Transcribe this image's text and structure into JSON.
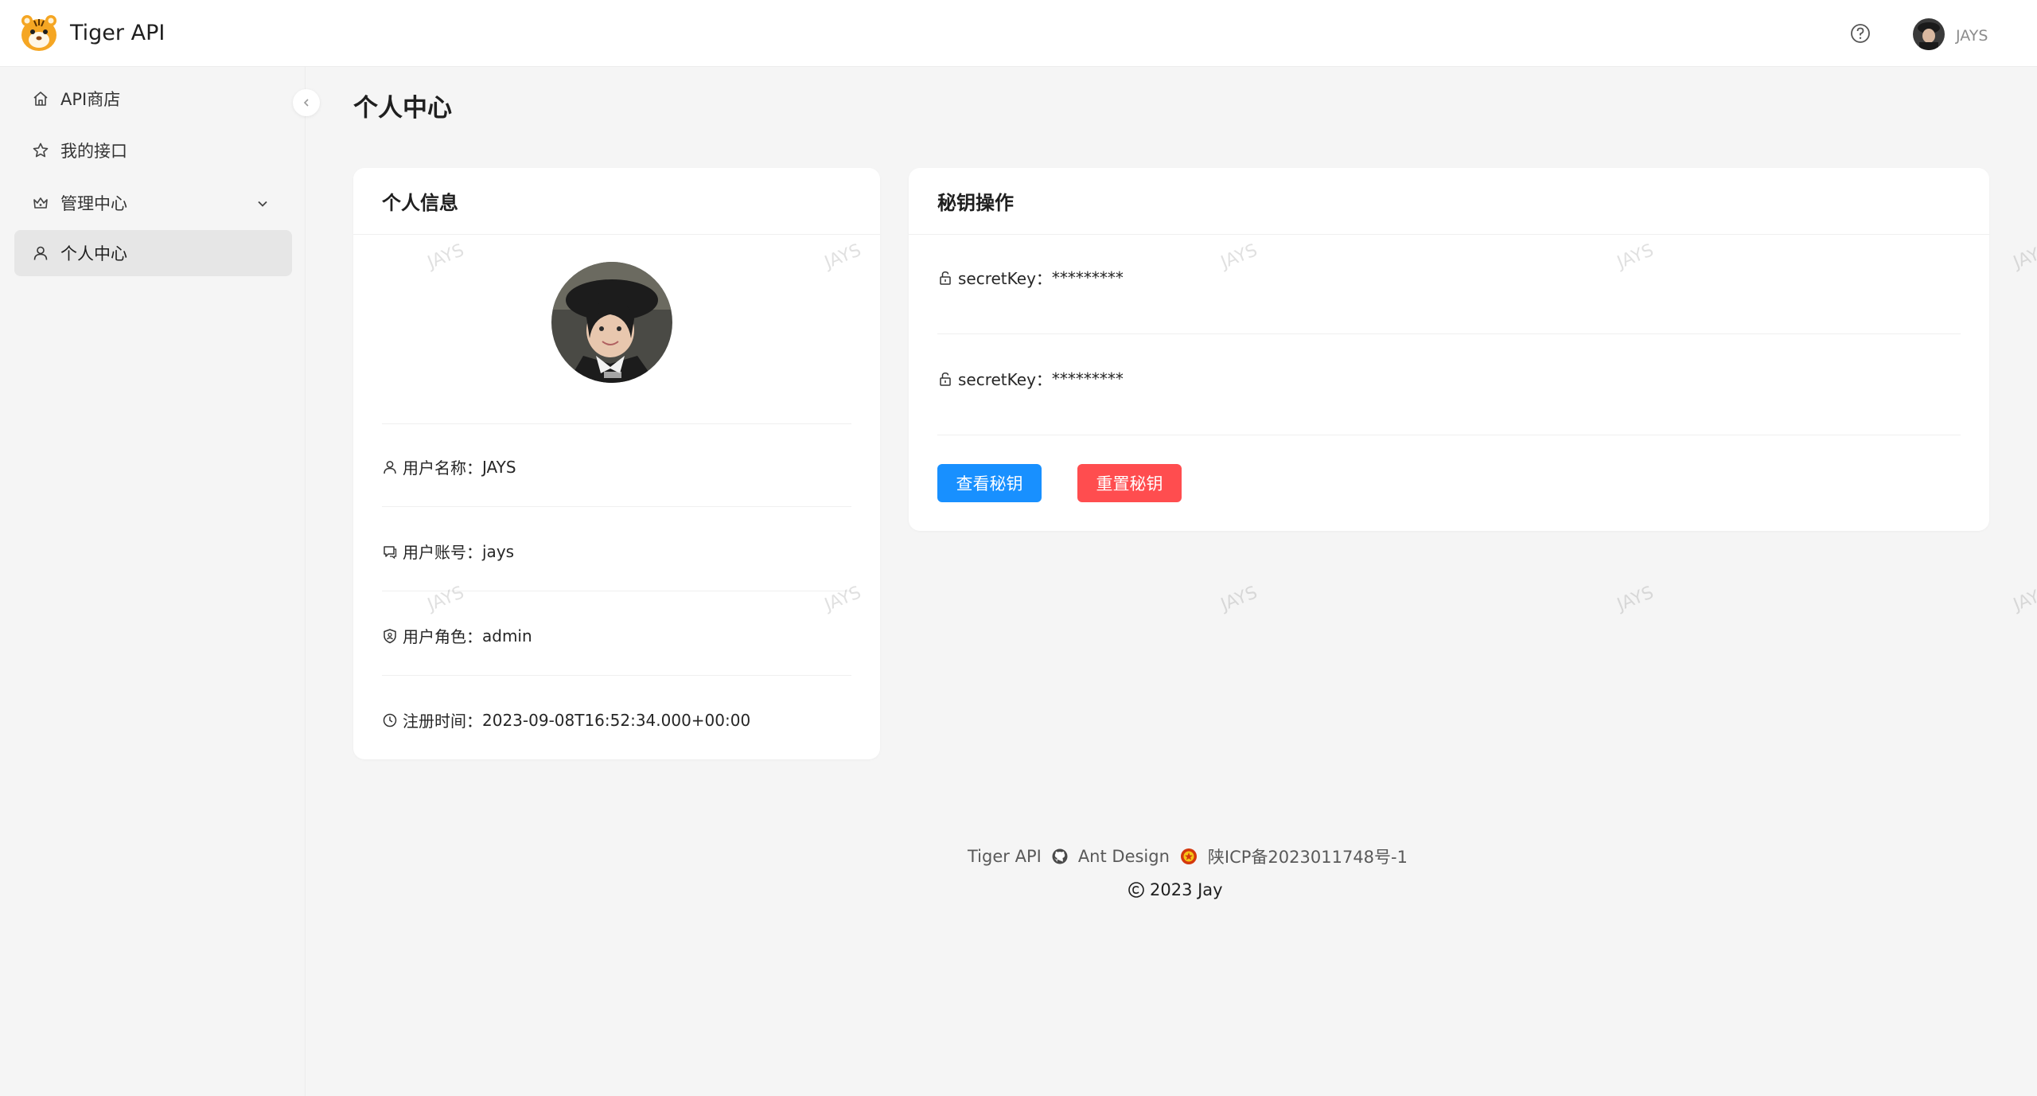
{
  "app": {
    "title": "Tiger API"
  },
  "header": {
    "username": "JAYS"
  },
  "sidebar": {
    "items": [
      {
        "label": "API商店"
      },
      {
        "label": "我的接口"
      },
      {
        "label": "管理中心"
      },
      {
        "label": "个人中心"
      }
    ],
    "active": "个人中心"
  },
  "page": {
    "title": "个人中心"
  },
  "profile_card": {
    "title": "个人信息",
    "rows": [
      {
        "label": "用户名称：",
        "value": "JAYS"
      },
      {
        "label": "用户账号：",
        "value": "jays"
      },
      {
        "label": "用户角色：",
        "value": "admin"
      },
      {
        "label": "注册时间：",
        "value": "2023-09-08T16:52:34.000+00:00"
      }
    ]
  },
  "secret_card": {
    "title": "秘钥操作",
    "rows": [
      {
        "label": "secretKey：",
        "value": "*********"
      },
      {
        "label": "secretKey：",
        "value": "*********"
      }
    ],
    "view_button": "查看秘钥",
    "reset_button": "重置秘钥"
  },
  "watermark": {
    "text": "JAYS"
  },
  "footer": {
    "links": [
      "Tiger API",
      "Ant Design",
      "陕ICP备2023011748号-1"
    ],
    "copyright": "2023 Jay"
  },
  "colors": {
    "primary": "#1890ff",
    "danger": "#ff4d4f",
    "background": "#f5f5f5"
  }
}
